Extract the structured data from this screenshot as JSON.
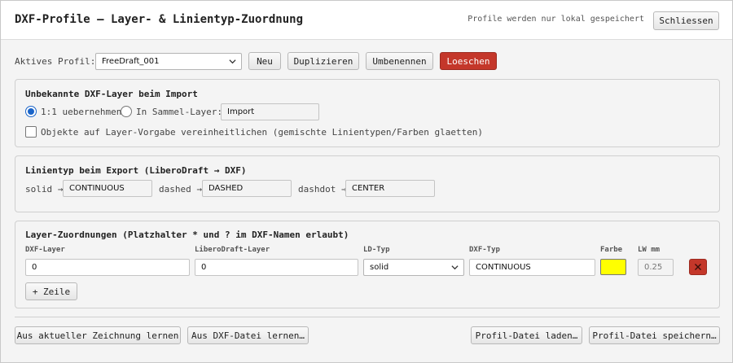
{
  "header": {
    "title": "DXF-Profile — Layer- & Linientyp-Zuordnung",
    "note": "Profile werden nur lokal gespeichert",
    "close_label": "Schliessen"
  },
  "profile_bar": {
    "label": "Aktives Profil:",
    "selected": "FreeDraft_001",
    "new_label": "Neu",
    "duplicate_label": "Duplizieren",
    "rename_label": "Umbenennen",
    "delete_label": "Loeschen"
  },
  "unknown_layers": {
    "title": "Unbekannte DXF-Layer beim Import",
    "option_keep": "1:1 uebernehmen",
    "option_collect": "In Sammel-Layer:",
    "collect_value": "Import",
    "normalize_label": "Objekte auf Layer-Vorgabe vereinheitlichen (gemischte Linientypen/Farben glaetten)",
    "selected_option": "keep",
    "normalize_checked": false
  },
  "linetype_export": {
    "title": "Linientyp beim Export (LiberoDraft → DXF)",
    "mappings": [
      {
        "from": "solid →",
        "to": "CONTINUOUS"
      },
      {
        "from": "dashed →",
        "to": "DASHED"
      },
      {
        "from": "dashdot →",
        "to": "CENTER"
      }
    ]
  },
  "layer_mapping": {
    "title": "Layer-Zuordnungen (Platzhalter * und ? im DXF-Namen erlaubt)",
    "columns": {
      "dxf_layer": "DXF-Layer",
      "ld_layer": "LiberoDraft-Layer",
      "ld_type": "LD-Typ",
      "dxf_type": "DXF-Typ",
      "color": "Farbe",
      "lw": "LW mm"
    },
    "rows": [
      {
        "dxf_layer": "0",
        "ld_layer": "0",
        "ld_type": "solid",
        "dxf_type": "CONTINUOUS",
        "color": "#ffff00",
        "lw": "0.25"
      }
    ],
    "add_row_label": "+ Zeile"
  },
  "footer": {
    "learn_drawing_label": "Aus aktueller Zeichnung lernen",
    "learn_file_label": "Aus DXF-Datei lernen…",
    "load_profile_label": "Profil-Datei laden…",
    "save_profile_label": "Profil-Datei speichern…"
  },
  "colors": {
    "accent": "#1a64c8",
    "danger": "#c4372a"
  },
  "icons": {
    "dropdown": "chevron-down-icon",
    "delete_row": "close-icon"
  }
}
